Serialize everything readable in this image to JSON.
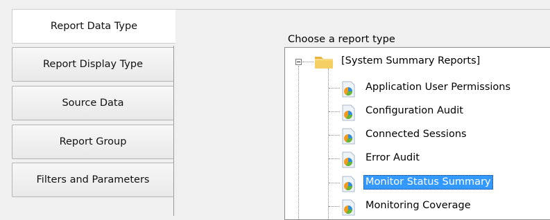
{
  "tabs": [
    {
      "label": "Report Data Type",
      "active": true
    },
    {
      "label": "Report Display Type",
      "active": false
    },
    {
      "label": "Source Data",
      "active": false
    },
    {
      "label": "Report Group",
      "active": false
    },
    {
      "label": "Filters and Parameters",
      "active": false
    }
  ],
  "main": {
    "choose_label": "Choose a report type",
    "tree": {
      "root_label": "[System Summary Reports]",
      "root_icon": "folder-icon",
      "items": [
        {
          "label": "Application User Permissions",
          "icon": "report-icon",
          "selected": false
        },
        {
          "label": "Configuration Audit",
          "icon": "report-icon",
          "selected": false
        },
        {
          "label": "Connected Sessions",
          "icon": "report-icon",
          "selected": false
        },
        {
          "label": "Error Audit",
          "icon": "report-icon",
          "selected": false
        },
        {
          "label": "Monitor Status Summary",
          "icon": "report-icon",
          "selected": true
        },
        {
          "label": "Monitoring Coverage",
          "icon": "report-icon",
          "selected": false
        }
      ]
    }
  },
  "colors": {
    "selection": "#3399ff",
    "folder": "#f2c14e",
    "icon_blue": "#2e8ee0",
    "icon_green": "#63b63a",
    "icon_orange": "#f39a1e"
  }
}
